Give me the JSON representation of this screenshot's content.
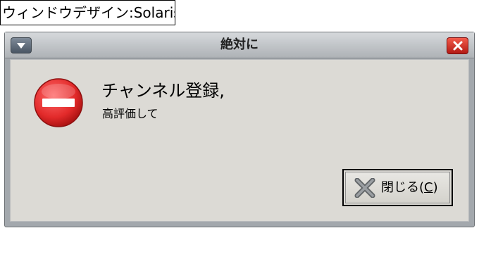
{
  "caption": "ウィンドウデザイン:Solaris",
  "window": {
    "title": "絶対に",
    "message_title": "チャンネル登録,",
    "message_body": "高評価して",
    "button": {
      "label": "閉じる(",
      "mnemonic": "C",
      "label_end": ")"
    },
    "icons": {
      "window_menu": "chevron-down-icon",
      "window_close": "close-icon",
      "dialog": "error-icon",
      "button": "close-x-icon"
    },
    "colors": {
      "error_red": "#e22a2a",
      "close_button_red": "#d0392b",
      "client_background": "#dcdad5"
    }
  }
}
